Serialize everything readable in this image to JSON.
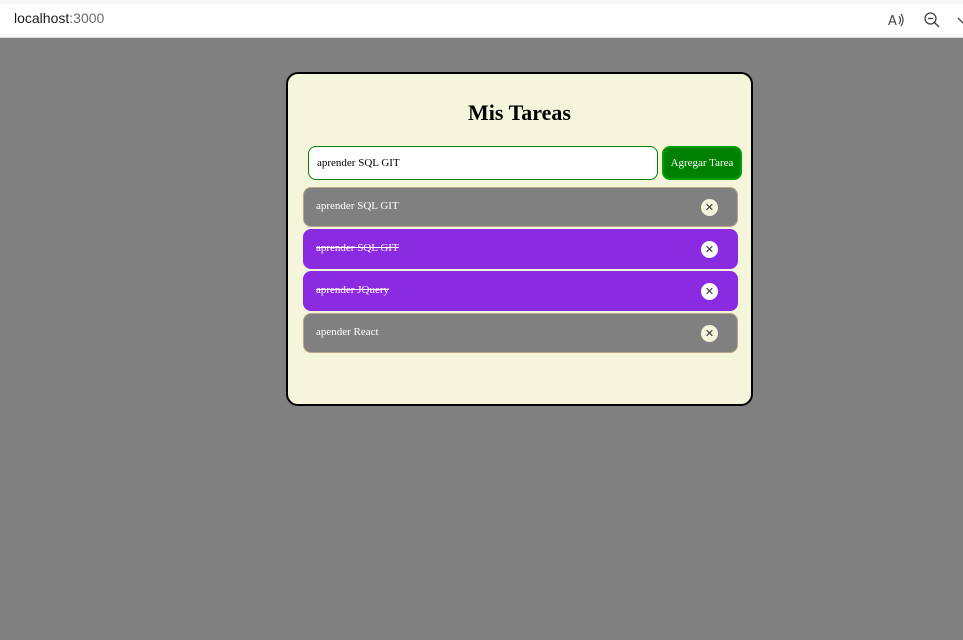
{
  "browser": {
    "url_host": "localhost",
    "url_port": ":3000",
    "icons": [
      "read-aloud-icon",
      "zoom-out-icon",
      "chevron-down-icon"
    ]
  },
  "app": {
    "title": "Mis Tareas",
    "input_value": "aprender SQL GIT",
    "add_button_label": "Agregar Tarea",
    "remove_icon": "close-icon",
    "colors": {
      "background": "#808080",
      "card": "#f5f5dc",
      "accent_green": "#008000",
      "pending_task": "#808080",
      "done_task": "#8a2be2"
    },
    "tasks": [
      {
        "text": "aprender SQL GIT",
        "completed": false
      },
      {
        "text": "aprender SQL GIT",
        "completed": true
      },
      {
        "text": "aprender JQuery",
        "completed": true
      },
      {
        "text": "apender React",
        "completed": false
      }
    ]
  }
}
